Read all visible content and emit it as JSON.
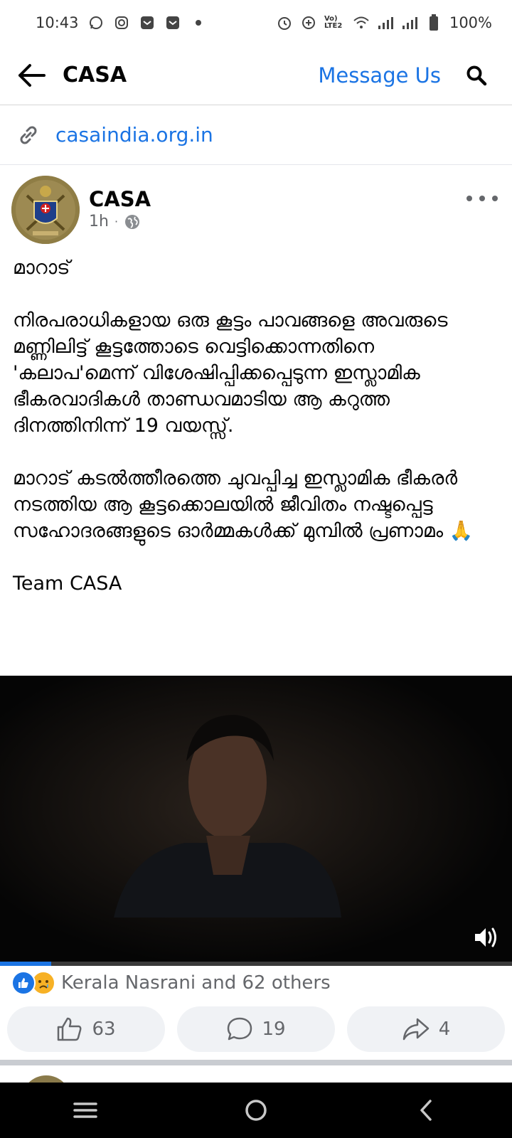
{
  "status_bar": {
    "time": "10:43",
    "battery": "100%",
    "network_label": "Vo) LTE2"
  },
  "app_bar": {
    "title": "CASA",
    "message_button": "Message Us"
  },
  "link": {
    "url": "casaindia.org.in"
  },
  "post": {
    "page_name": "CASA",
    "time": "1h",
    "paragraphs": [
      "മാറാട്",
      "നിരപരാധികളായ ഒരു കൂട്ടം പാവങ്ങളെ അവരുടെ മണ്ണിലിട്ട് കൂട്ടത്തോടെ വെട്ടിക്കൊന്നതിനെ  'കലാപ'മെന്ന് വിശേഷിപ്പിക്കപ്പെടുന്ന ഇസ്ലാമിക ഭീകരവാദികൾ താണ്ഡവമാടിയ ആ കറുത്ത ദിനത്തിനിന്ന് 19 വയസ്സ്.",
      "മാറാട് കടൽത്തീരത്തെ ചുവപ്പിച്ച ഇസ്ലാമിക ഭീകരർ നടത്തിയ ആ കൂട്ടക്കൊലയിൽ ജീവിതം നഷ്ടപ്പെട്ട സഹോദരങ്ങളുടെ ഓർമ്മകൾക്ക് മുമ്പിൽ പ്രണാമം 🙏",
      "Team CASA"
    ],
    "video": {
      "progress": 0.1
    },
    "reactions_text": "Kerala Nasrani and 62 others",
    "like_count": "63",
    "comment_count": "19",
    "share_count": "4"
  },
  "colors": {
    "accent": "#1b74e4",
    "text": "#050505",
    "muted": "#65676b"
  },
  "icons": [
    "back-arrow-icon",
    "search-icon",
    "link-icon",
    "globe-icon",
    "more-icon",
    "volume-icon",
    "like-icon",
    "comment-icon",
    "share-icon",
    "menu-icon",
    "home-icon",
    "back-icon"
  ]
}
